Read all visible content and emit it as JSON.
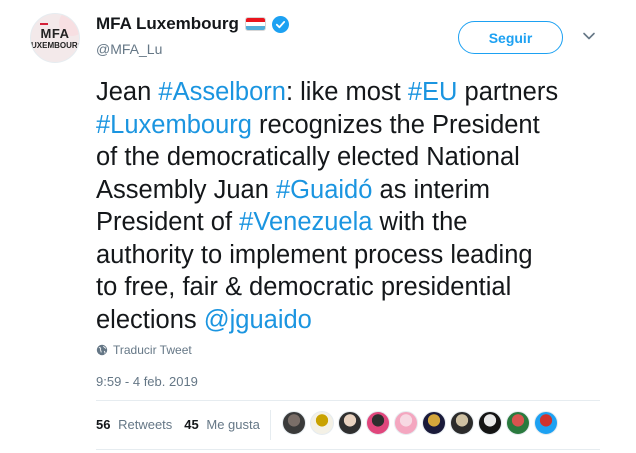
{
  "account": {
    "display_name": "MFA Luxembourg",
    "handle": "@MFA_Lu",
    "avatar_logo_line1": "MFA",
    "avatar_logo_line2": "LUXEMBOURG",
    "flag_colors": [
      "#ea141d",
      "#ffffff",
      "#51adda"
    ],
    "verified_color": "#1da1f2"
  },
  "follow_button": {
    "label": "Seguir"
  },
  "tweet": {
    "lines": [
      [
        {
          "t": "Jean ",
          "tag": false
        },
        {
          "t": "#Asselborn",
          "tag": true
        },
        {
          "t": ": like most ",
          "tag": false
        },
        {
          "t": "#EU",
          "tag": true
        },
        {
          "t": " partners",
          "tag": false
        }
      ],
      [
        {
          "t": "#Luxembourg",
          "tag": true
        },
        {
          "t": " recognizes the President",
          "tag": false
        }
      ],
      [
        {
          "t": "of the democratically elected National",
          "tag": false
        }
      ],
      [
        {
          "t": "Assembly Juan ",
          "tag": false
        },
        {
          "t": "#Guaidó",
          "tag": true
        },
        {
          "t": " as interim",
          "tag": false
        }
      ],
      [
        {
          "t": "President of ",
          "tag": false
        },
        {
          "t": "#Venezuela",
          "tag": true
        },
        {
          "t": " with the",
          "tag": false
        }
      ],
      [
        {
          "t": "authority to implement process leading",
          "tag": false
        }
      ],
      [
        {
          "t": "to free, fair & democratic presidential",
          "tag": false
        }
      ],
      [
        {
          "t": "elections ",
          "tag": false
        },
        {
          "t": "@jguaido",
          "tag": true
        }
      ]
    ],
    "translate_label": "Traducir Tweet",
    "timestamp": "9:59 - 4 feb. 2019"
  },
  "stats": {
    "retweets_count": "56",
    "retweets_label": "Retweets",
    "likes_count": "45",
    "likes_label": "Me gusta"
  },
  "likers": [
    {
      "colors": [
        "#3a3a3a",
        "#7a6e68"
      ]
    },
    {
      "colors": [
        "#f4f1e6",
        "#c9a200"
      ]
    },
    {
      "colors": [
        "#2f2f2f",
        "#e8d2c0"
      ]
    },
    {
      "colors": [
        "#e0467c",
        "#2e2e2e"
      ]
    },
    {
      "colors": [
        "#f4a7c0",
        "#f7d9e3"
      ]
    },
    {
      "colors": [
        "#1a1a3a",
        "#d4a63b"
      ]
    },
    {
      "colors": [
        "#2b2b2b",
        "#cfc1a3"
      ]
    },
    {
      "colors": [
        "#141414",
        "#e9e9e9"
      ]
    },
    {
      "colors": [
        "#2a7a3e",
        "#d9534f"
      ]
    },
    {
      "colors": [
        "#1da1f2",
        "#d0312d"
      ]
    }
  ]
}
